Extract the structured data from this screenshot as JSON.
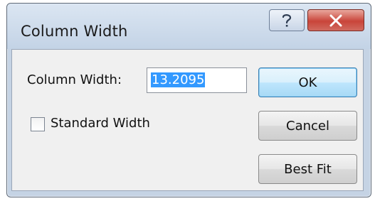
{
  "window": {
    "title": "Column Width",
    "help_glyph": "?",
    "close_glyph": "✕"
  },
  "form": {
    "column_width_label": "Column Width:",
    "column_width_value": "13.2095",
    "standard_width_label": "Standard Width",
    "standard_width_checked": false
  },
  "buttons": {
    "ok": "OK",
    "cancel": "Cancel",
    "best_fit": "Best Fit"
  },
  "icons": {
    "help": "help-icon",
    "close": "close-icon"
  },
  "colors": {
    "selection": "#3399ff",
    "close_button": "#c9453a"
  }
}
